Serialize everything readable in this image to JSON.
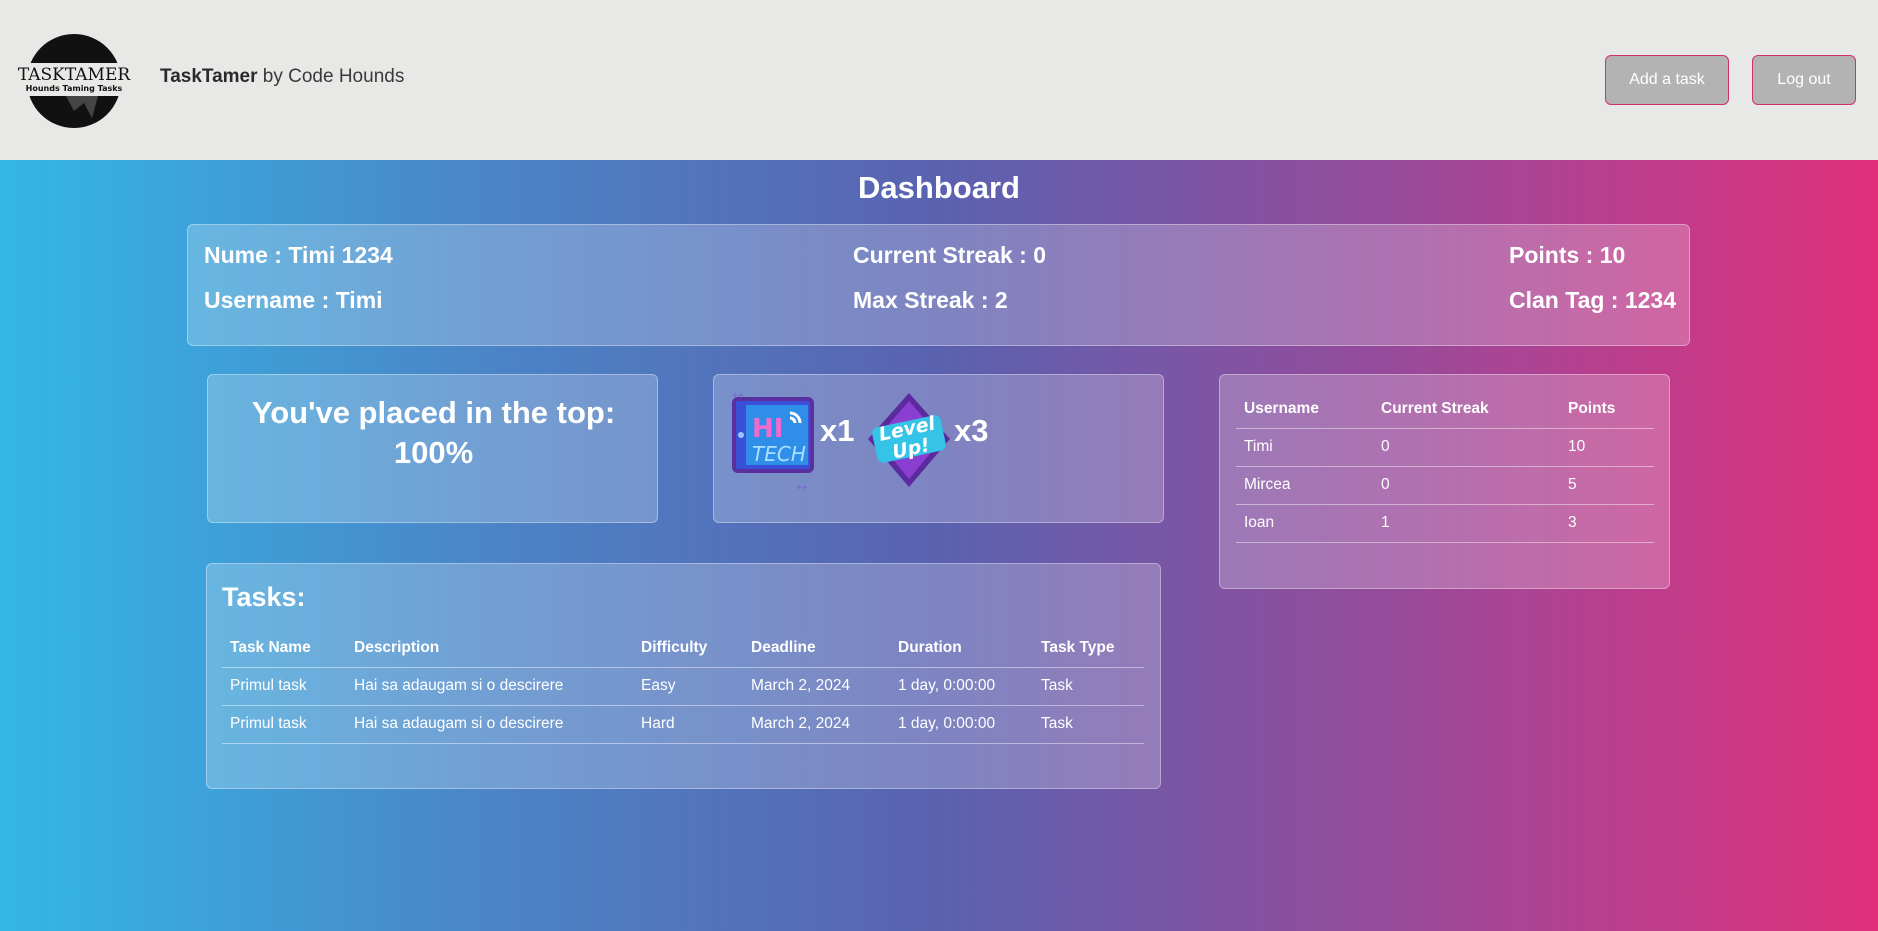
{
  "header": {
    "brand_name": "TaskTamer",
    "brand_suffix": " by Code Hounds",
    "logo_text": "TASKTAMER",
    "logo_tagline": "Hounds Taming Tasks",
    "add_task_label": "Add a task",
    "logout_label": "Log out"
  },
  "page_title": "Dashboard",
  "profile": {
    "name": "Nume : Timi 1234",
    "username": "Username : Timi",
    "current_streak": "Current Streak : 0",
    "max_streak": "Max Streak : 2",
    "points": "Points : 10",
    "clan_tag": "Clan Tag : 1234"
  },
  "rank": {
    "text": "You've placed in the top:",
    "value": "100%"
  },
  "badges": [
    {
      "icon": "hi-tech-badge-icon",
      "label_top": "HI",
      "label_bottom": "TECH",
      "count": "x1"
    },
    {
      "icon": "level-up-badge-icon",
      "label_top": "Level",
      "label_bottom": "Up!",
      "count": "x3"
    }
  ],
  "leaderboard": {
    "headers": [
      "Username",
      "Current Streak",
      "Points"
    ],
    "rows": [
      [
        "Timi",
        "0",
        "10"
      ],
      [
        "Mircea",
        "0",
        "5"
      ],
      [
        "Ioan",
        "1",
        "3"
      ]
    ]
  },
  "tasks": {
    "title": "Tasks:",
    "headers": [
      "Task Name",
      "Description",
      "Difficulty",
      "Deadline",
      "Duration",
      "Task Type"
    ],
    "rows": [
      [
        "Primul task",
        "Hai sa adaugam si o descirere",
        "Easy",
        "March 2, 2024",
        "1 day, 0:00:00",
        "Task"
      ],
      [
        "Primul task",
        "Hai sa adaugam si o descirere",
        "Hard",
        "March 2, 2024",
        "1 day, 0:00:00",
        "Task"
      ]
    ]
  },
  "colors": {
    "gradient_start": "#33b7e6",
    "gradient_end": "#e0307c",
    "topbar": "#e8e8e6",
    "button_bg": "#b3b3b3",
    "button_border": "#d2316e"
  }
}
